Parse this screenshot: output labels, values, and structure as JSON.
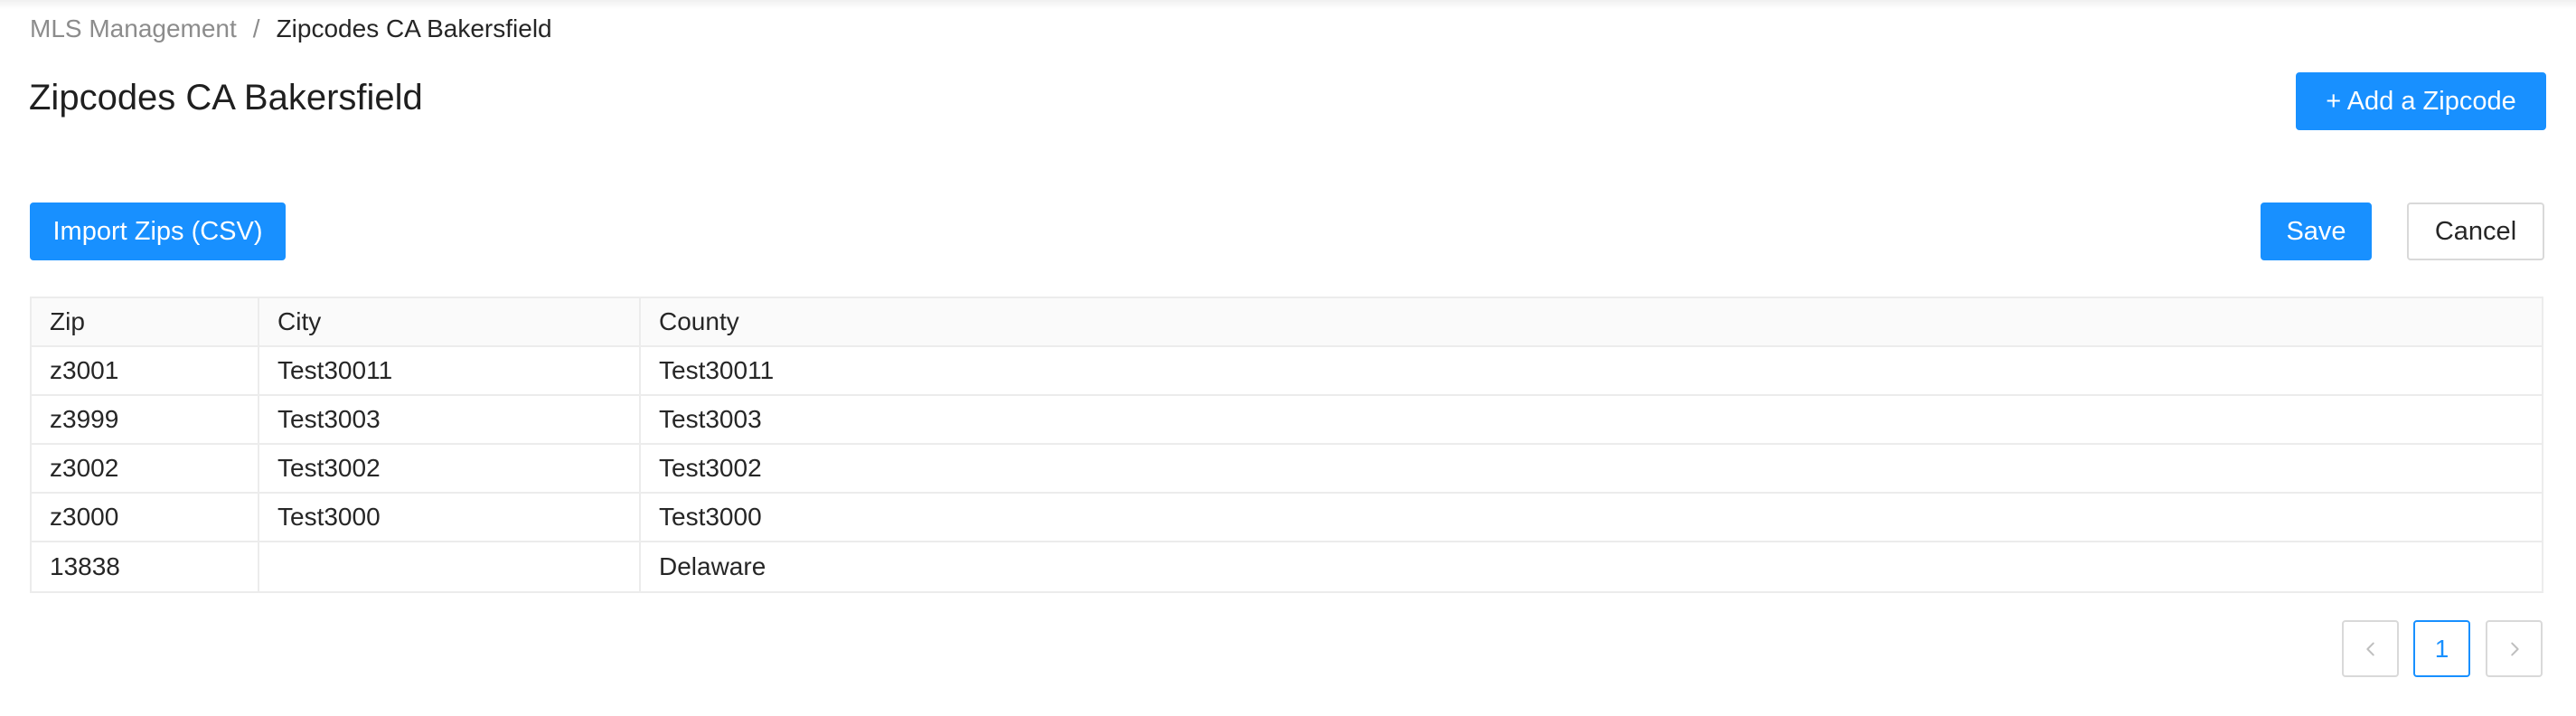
{
  "breadcrumb": {
    "parent": "MLS Management",
    "separator": "/",
    "current": "Zipcodes CA Bakersfield"
  },
  "page": {
    "title": "Zipcodes CA Bakersfield"
  },
  "actions": {
    "add_zipcode": "+ Add a Zipcode",
    "import_zips": "Import Zips (CSV)",
    "save": "Save",
    "cancel": "Cancel"
  },
  "table": {
    "columns": [
      "Zip",
      "City",
      "County"
    ],
    "rows": [
      {
        "zip": "z3001",
        "city": "Test30011",
        "county": "Test30011"
      },
      {
        "zip": "z3999",
        "city": "Test3003",
        "county": "Test3003"
      },
      {
        "zip": "z3002",
        "city": "Test3002",
        "county": "Test3002"
      },
      {
        "zip": "z3000",
        "city": "Test3000",
        "county": "Test3000"
      },
      {
        "zip": "13838",
        "city": "",
        "county": "Delaware"
      }
    ]
  },
  "pagination": {
    "current_page": "1",
    "prev_icon": "chevron-left-icon",
    "next_icon": "chevron-right-icon"
  },
  "colors": {
    "primary": "#1890ff",
    "border": "#d9d9d9",
    "header_bg": "#fafafa"
  }
}
